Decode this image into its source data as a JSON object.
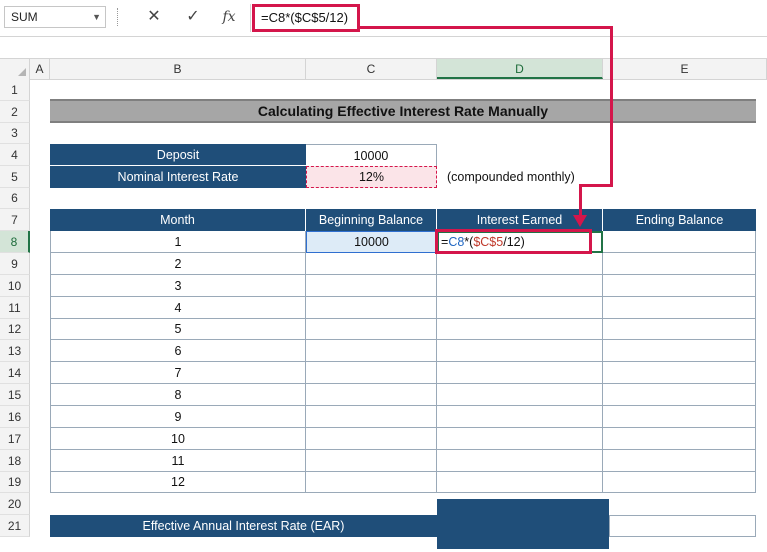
{
  "formula_bar": {
    "name_box": "SUM",
    "cancel_icon": "✕",
    "enter_icon": "✓",
    "fx_label": "fx",
    "formula": "=C8*($C$5/12)"
  },
  "columns": [
    "A",
    "B",
    "C",
    "D",
    "E"
  ],
  "rows": [
    "1",
    "2",
    "3",
    "4",
    "5",
    "6",
    "7",
    "8",
    "9",
    "10",
    "11",
    "12",
    "13",
    "14",
    "15",
    "16",
    "17",
    "18",
    "19",
    "20",
    "21"
  ],
  "sheet": {
    "title": "Calculating Effective Interest Rate Manually",
    "deposit_label": "Deposit",
    "deposit_value": "10000",
    "rate_label": "Nominal Interest Rate",
    "rate_value": "12%",
    "rate_note": "(compounded monthly)",
    "table_headers": [
      "Month",
      "Beginning Balance",
      "Interest Earned",
      "Ending Balance"
    ],
    "months": [
      "1",
      "2",
      "3",
      "4",
      "5",
      "6",
      "7",
      "8",
      "9",
      "10",
      "11",
      "12"
    ],
    "first_beginning_balance": "10000",
    "editing_formula_parts": [
      "=",
      "C8",
      "*(",
      "$C$5",
      "/12)"
    ],
    "ear_label": "Effective Annual Interest Rate (EAR)"
  },
  "colors": {
    "navy": "#1f4e79",
    "highlight_red": "#d4164b",
    "excel_green": "#217346"
  }
}
